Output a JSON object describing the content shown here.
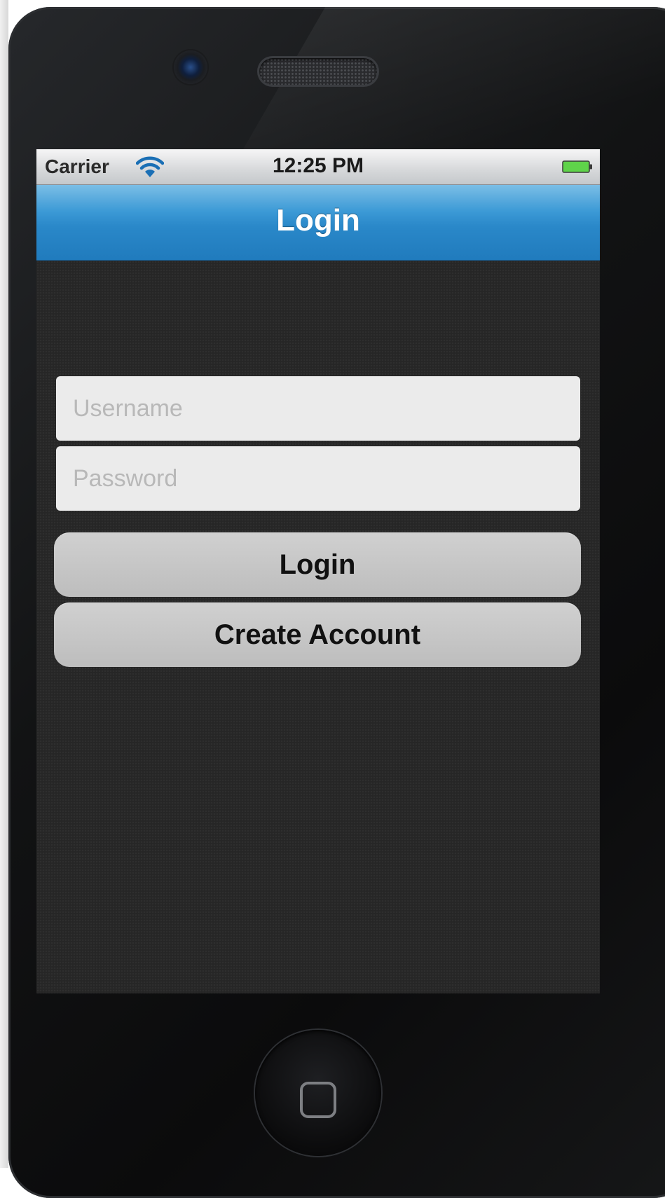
{
  "status_bar": {
    "carrier": "Carrier",
    "time": "12:25 PM",
    "wifi_icon": "wifi-icon",
    "battery_icon": "battery-full-icon",
    "battery_color": "#5fd34a"
  },
  "nav_bar": {
    "title": "Login",
    "color": "#2a88c9"
  },
  "form": {
    "username": {
      "placeholder": "Username",
      "value": ""
    },
    "password": {
      "placeholder": "Password",
      "value": ""
    }
  },
  "buttons": {
    "login_label": "Login",
    "create_account_label": "Create Account"
  }
}
